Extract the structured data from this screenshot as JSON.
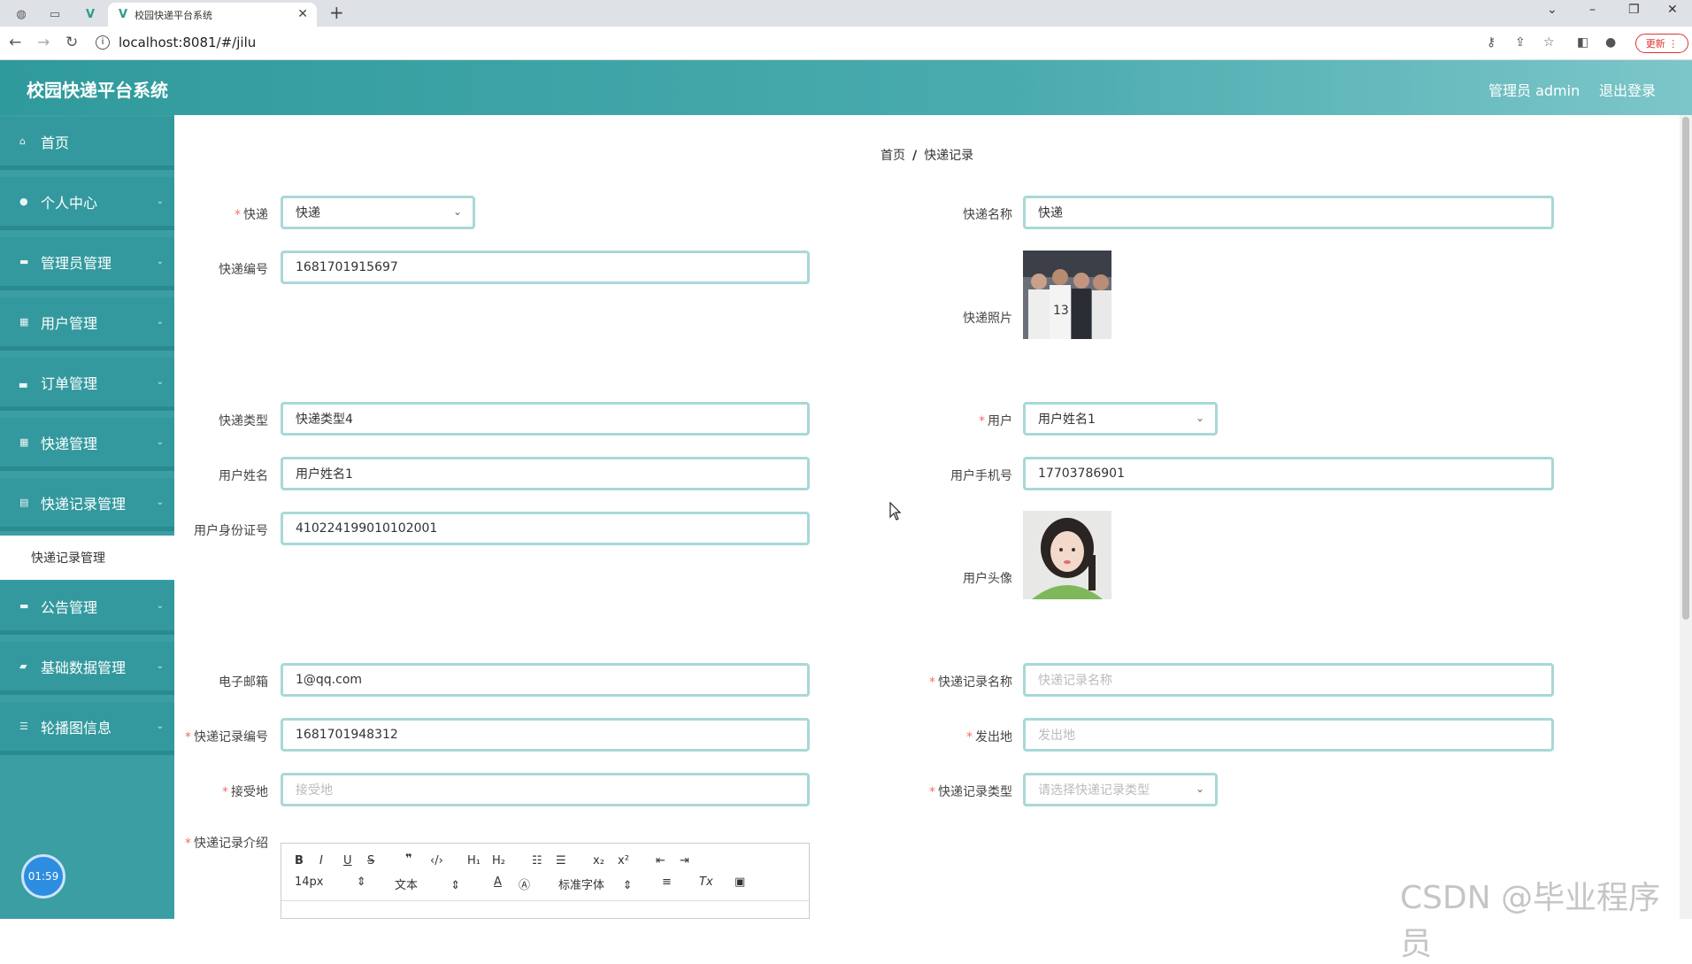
{
  "browser": {
    "tab_title": "校园快递平台系统",
    "url": "localhost:8081/#/jilu",
    "update_label": "更新"
  },
  "header": {
    "title": "校园快递平台系统",
    "admin_label": "管理员 admin",
    "logout_label": "退出登录"
  },
  "sidebar": {
    "items": [
      {
        "label": "首页",
        "icon": "home-icon"
      },
      {
        "label": "个人中心",
        "icon": "user-icon"
      },
      {
        "label": "管理员管理",
        "icon": "chat-icon"
      },
      {
        "label": "用户管理",
        "icon": "grid-icon"
      },
      {
        "label": "订单管理",
        "icon": "briefcase-icon"
      },
      {
        "label": "快递管理",
        "icon": "grid-icon"
      },
      {
        "label": "快递记录管理",
        "icon": "lock-icon"
      },
      {
        "label": "公告管理",
        "icon": "chat-icon"
      },
      {
        "label": "基础数据管理",
        "icon": "chart-icon"
      },
      {
        "label": "轮播图信息",
        "icon": "sliders-icon"
      }
    ],
    "submenu_label": "快递记录管理",
    "clock": "01:59"
  },
  "breadcrumb": {
    "home": "首页",
    "sep": "/",
    "current": "快递记录"
  },
  "form": {
    "express_label": "快递",
    "express_value": "快递",
    "express_name_label": "快递名称",
    "express_name_value": "快递",
    "express_no_label": "快递编号",
    "express_no_value": "1681701915697",
    "express_photo_label": "快递照片",
    "express_type_label": "快递类型",
    "express_type_value": "快递类型4",
    "user_label": "用户",
    "user_value": "用户姓名1",
    "user_name_label": "用户姓名",
    "user_name_value": "用户姓名1",
    "user_phone_label": "用户手机号",
    "user_phone_value": "17703786901",
    "user_id_label": "用户身份证号",
    "user_id_value": "410224199010102001",
    "user_avatar_label": "用户头像",
    "email_label": "电子邮箱",
    "email_value": "1@qq.com",
    "record_name_label": "快递记录名称",
    "record_name_placeholder": "快递记录名称",
    "record_no_label": "快递记录编号",
    "record_no_value": "1681701948312",
    "origin_label": "发出地",
    "origin_placeholder": "发出地",
    "dest_label": "接受地",
    "dest_placeholder": "接受地",
    "record_type_label": "快递记录类型",
    "record_type_placeholder": "请选择快递记录类型",
    "intro_label": "快递记录介绍"
  },
  "editor": {
    "font_size": "14px",
    "text_style": "文本",
    "font_family": "标准字体"
  },
  "watermark": "CSDN @毕业程序员"
}
